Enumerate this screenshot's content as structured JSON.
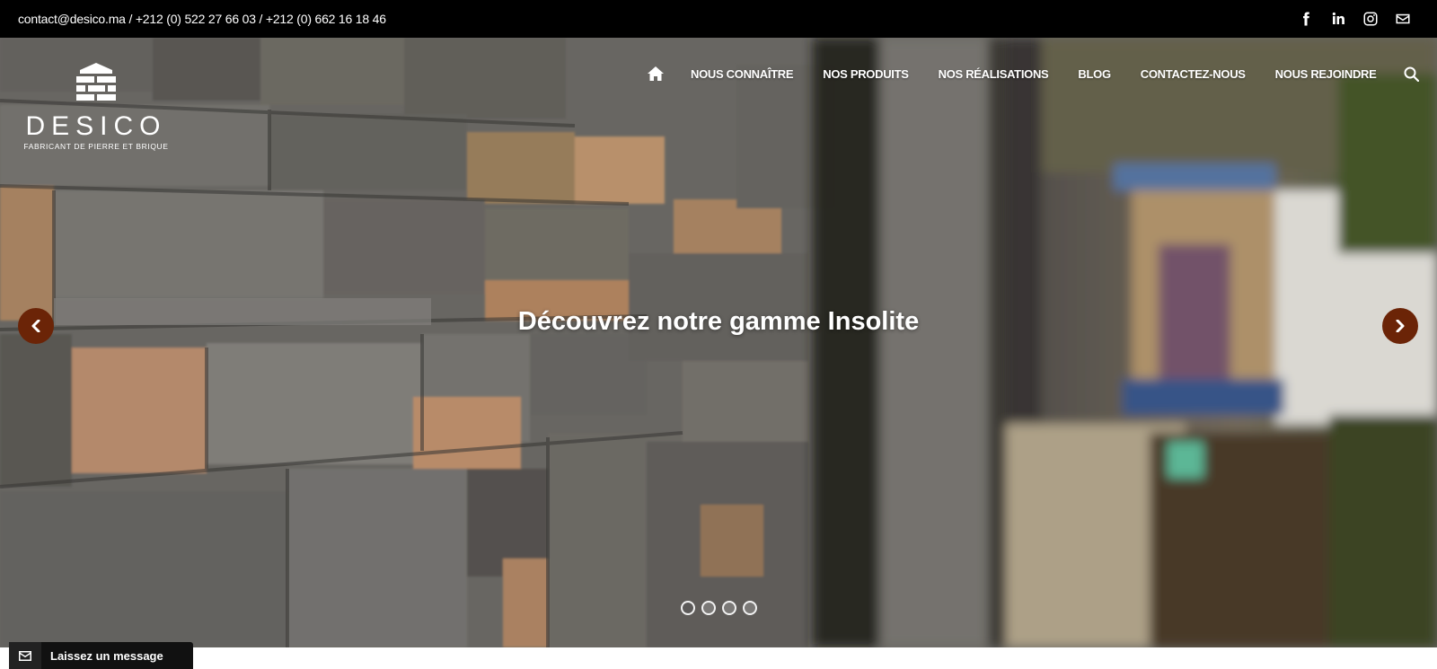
{
  "topbar": {
    "contact": "contact@desico.ma / +212 (0) 522 27 66 03 / +212 (0) 662 16 18 46",
    "social": [
      {
        "name": "facebook-icon"
      },
      {
        "name": "linkedin-icon"
      },
      {
        "name": "instagram-icon"
      },
      {
        "name": "envelope-icon"
      }
    ]
  },
  "logo": {
    "name": "DESICO",
    "tagline": "FABRICANT DE PIERRE ET BRIQUE"
  },
  "nav": {
    "home_icon": "home-icon",
    "items": [
      "NOUS CONNAÎTRE",
      "NOS PRODUITS",
      "NOS RÉALISATIONS",
      "BLOG",
      "CONTACTEZ-NOUS",
      "NOUS REJOINDRE"
    ],
    "search_icon": "search-icon"
  },
  "hero": {
    "caption": "Découvrez notre gamme Insolite",
    "slide_count": 4,
    "active_slide": 1
  },
  "widget": {
    "label": "Laissez un message"
  },
  "colors": {
    "topbar_bg": "#000000",
    "arrow_bg": "#6b2407",
    "text": "#ffffff"
  }
}
